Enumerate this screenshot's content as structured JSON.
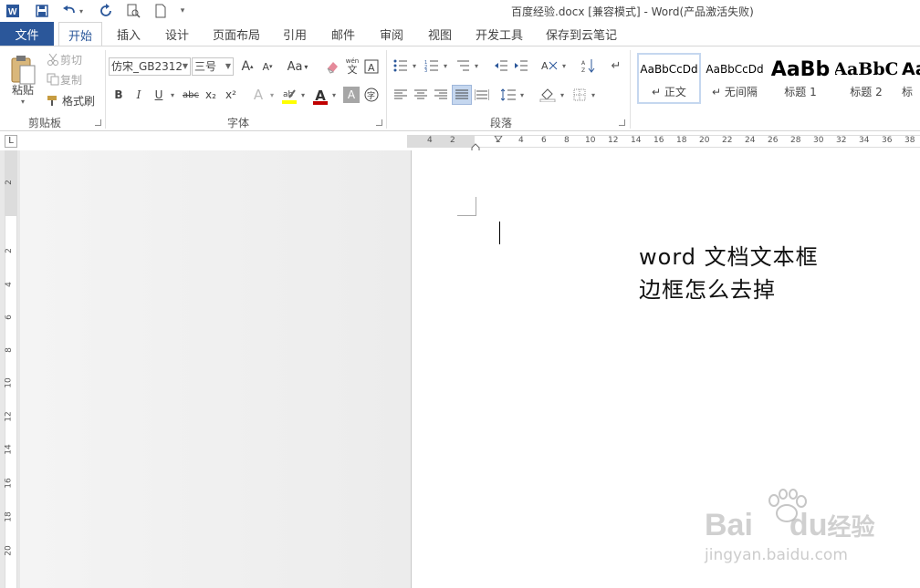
{
  "window": {
    "title": "百度经验.docx [兼容模式] - Word(产品激活失败)"
  },
  "tabs": {
    "file": "文件",
    "home": "开始",
    "insert": "插入",
    "design": "设计",
    "layout": "页面布局",
    "references": "引用",
    "mailings": "邮件",
    "review": "审阅",
    "view": "视图",
    "developer": "开发工具",
    "save_cloud": "保存到云笔记"
  },
  "clipboard": {
    "paste": "粘贴",
    "cut": "剪切",
    "copy": "复制",
    "format_painter": "格式刷",
    "group": "剪贴板"
  },
  "font": {
    "name": "仿宋_GB2312",
    "size": "三号",
    "group": "字体",
    "bold": "B",
    "italic": "I",
    "underline": "U",
    "strike": "abc",
    "subscript": "x₂",
    "superscript": "x²",
    "change_case": "Aa",
    "grow": "A",
    "shrink": "A",
    "font_color": "A"
  },
  "paragraph": {
    "group": "段落"
  },
  "styles": {
    "items": [
      {
        "preview": "AaBbCcDd",
        "name": "正文"
      },
      {
        "preview": "AaBbCcDd",
        "name": "无间隔"
      },
      {
        "preview": "AaBb",
        "name": "标题 1"
      },
      {
        "preview": "AaBbC",
        "name": "标题 2"
      },
      {
        "preview": "Aa",
        "name": "标"
      }
    ]
  },
  "ruler": {
    "h_left": [
      "4",
      "2"
    ],
    "h_right": [
      "2",
      "4",
      "6",
      "8",
      "10",
      "12",
      "14",
      "16",
      "18",
      "20",
      "22",
      "24",
      "26",
      "28",
      "30",
      "32",
      "34",
      "36",
      "38"
    ],
    "v": [
      "2",
      "2",
      "4",
      "6",
      "8",
      "10",
      "12",
      "14",
      "16",
      "18",
      "20"
    ]
  },
  "document": {
    "line1": "word  文档文本框",
    "line2": "边框怎么去掉"
  },
  "watermark": {
    "brand": "Bai",
    "brand2": "du",
    "jingyan": "经验",
    "url": "jingyan.baidu.com"
  },
  "colors": {
    "accent": "#2b579a",
    "highlight": "#ffff00",
    "font_red": "#c00000"
  }
}
